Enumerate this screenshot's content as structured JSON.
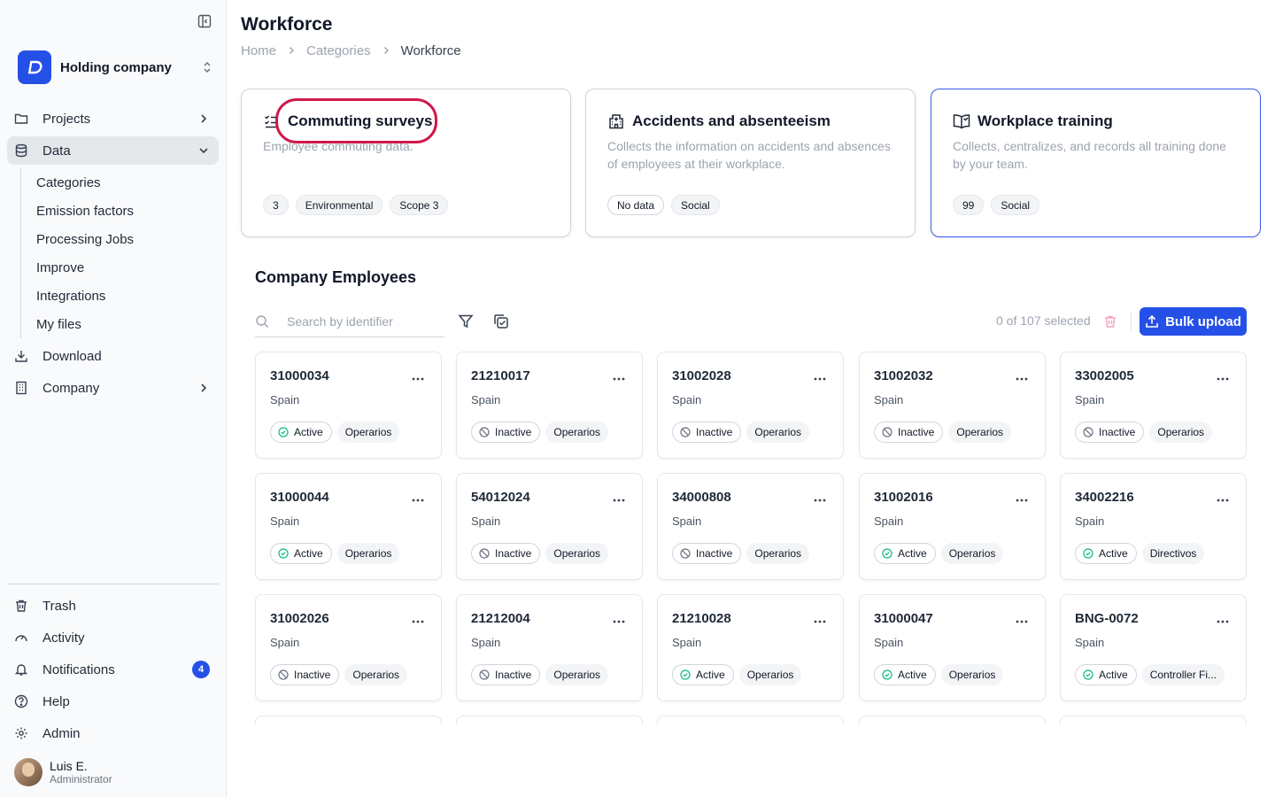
{
  "sidebar": {
    "company_name": "Holding company",
    "nav": [
      {
        "label": "Projects",
        "icon": "folder-icon"
      },
      {
        "label": "Data",
        "icon": "database-icon"
      },
      {
        "label": "Download",
        "icon": "download-icon"
      },
      {
        "label": "Company",
        "icon": "building-icon"
      }
    ],
    "data_subnav": [
      "Categories",
      "Emission factors",
      "Processing Jobs",
      "Improve",
      "Integrations",
      "My files"
    ],
    "bottom_nav": [
      {
        "label": "Trash",
        "icon": "trash-icon"
      },
      {
        "label": "Activity",
        "icon": "gauge-icon"
      },
      {
        "label": "Notifications",
        "icon": "bell-icon",
        "badge": "4"
      },
      {
        "label": "Help",
        "icon": "help-circle-icon"
      },
      {
        "label": "Admin",
        "icon": "gear-icon"
      }
    ],
    "user": {
      "name": "Luis E.",
      "role": "Administrator"
    }
  },
  "header": {
    "title": "Workforce",
    "breadcrumb": [
      "Home",
      "Categories",
      "Workforce"
    ]
  },
  "categories": [
    {
      "title": "Commuting surveys",
      "description": "Employee commuting data.",
      "tags": [
        "3",
        "Environmental",
        "Scope 3"
      ],
      "icon": "list-check-icon"
    },
    {
      "title": "Accidents and absenteeism",
      "description": "Collects the information on accidents and absences of employees at their workplace.",
      "tags": [
        "No data",
        "Social"
      ],
      "icon": "hospital-icon"
    },
    {
      "title": "Workplace training",
      "description": "Collects, centralizes, and records all training done by your team.",
      "tags": [
        "99",
        "Social"
      ],
      "icon": "book-open-icon"
    }
  ],
  "employees_section": {
    "title": "Company Employees",
    "search_placeholder": "Search by identifier",
    "selection": "0 of 107 selected",
    "bulk_upload": "Bulk upload"
  },
  "colors": {
    "accent": "#2550e8",
    "active_status": "#10b981",
    "highlight": "#d1184a"
  },
  "employees": [
    {
      "id": "31000034",
      "country": "Spain",
      "status": "Active",
      "role": "Operarios"
    },
    {
      "id": "21210017",
      "country": "Spain",
      "status": "Inactive",
      "role": "Operarios"
    },
    {
      "id": "31002028",
      "country": "Spain",
      "status": "Inactive",
      "role": "Operarios"
    },
    {
      "id": "31002032",
      "country": "Spain",
      "status": "Inactive",
      "role": "Operarios"
    },
    {
      "id": "33002005",
      "country": "Spain",
      "status": "Inactive",
      "role": "Operarios"
    },
    {
      "id": "31000044",
      "country": "Spain",
      "status": "Active",
      "role": "Operarios"
    },
    {
      "id": "54012024",
      "country": "Spain",
      "status": "Inactive",
      "role": "Operarios"
    },
    {
      "id": "34000808",
      "country": "Spain",
      "status": "Inactive",
      "role": "Operarios"
    },
    {
      "id": "31002016",
      "country": "Spain",
      "status": "Active",
      "role": "Operarios"
    },
    {
      "id": "34002216",
      "country": "Spain",
      "status": "Active",
      "role": "Directivos"
    },
    {
      "id": "31002026",
      "country": "Spain",
      "status": "Inactive",
      "role": "Operarios"
    },
    {
      "id": "21212004",
      "country": "Spain",
      "status": "Inactive",
      "role": "Operarios"
    },
    {
      "id": "21210028",
      "country": "Spain",
      "status": "Active",
      "role": "Operarios"
    },
    {
      "id": "31000047",
      "country": "Spain",
      "status": "Active",
      "role": "Operarios"
    },
    {
      "id": "BNG-0072",
      "country": "Spain",
      "status": "Active",
      "role": "Controller Fi..."
    }
  ]
}
